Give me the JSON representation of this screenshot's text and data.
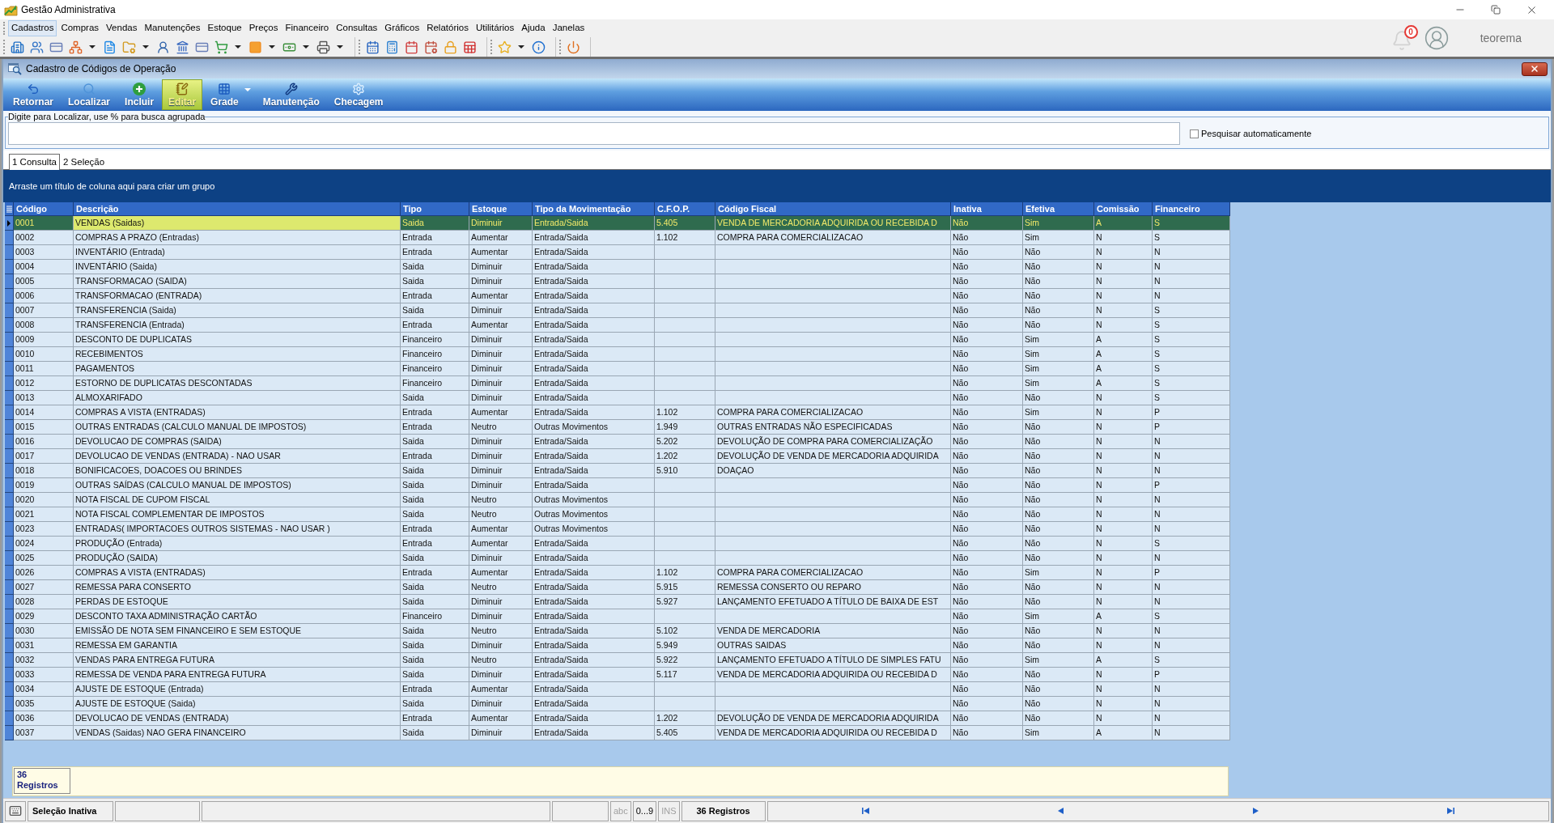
{
  "window": {
    "title": "Gestão Administrativa"
  },
  "menu": [
    {
      "label": "Cadastros",
      "selected": true
    },
    {
      "label": "Compras",
      "selected": false
    },
    {
      "label": "Vendas",
      "selected": false
    },
    {
      "label": "Manutenções",
      "selected": false
    },
    {
      "label": "Estoque",
      "selected": false
    },
    {
      "label": "Preços",
      "selected": false
    },
    {
      "label": "Financeiro",
      "selected": false
    },
    {
      "label": "Consultas",
      "selected": false
    },
    {
      "label": "Gráficos",
      "selected": false
    },
    {
      "label": "Relatórios",
      "selected": false
    },
    {
      "label": "Utilitários",
      "selected": false
    },
    {
      "label": "Ajuda",
      "selected": false
    },
    {
      "label": "Janelas",
      "selected": false
    }
  ],
  "toolbar": {
    "groups": [
      [
        {
          "dropdown": false
        },
        {
          "dropdown": false
        },
        {
          "dropdown": false
        },
        {
          "dropdown": true
        },
        {
          "dropdown": false
        },
        {
          "dropdown": true
        },
        {
          "dropdown": false
        },
        {
          "dropdown": false
        },
        {
          "dropdown": false
        },
        {
          "dropdown": true
        },
        {
          "dropdown": true
        },
        {
          "dropdown": true
        },
        {
          "dropdown": true
        }
      ],
      [
        {
          "dropdown": false
        },
        {
          "dropdown": false
        },
        {
          "dropdown": false
        },
        {
          "dropdown": false
        },
        {
          "dropdown": false
        },
        {
          "dropdown": false
        }
      ],
      [
        {
          "dropdown": true
        },
        {
          "dropdown": false
        }
      ],
      [
        {
          "dropdown": false
        }
      ]
    ]
  },
  "notifications": {
    "count": "0"
  },
  "user": {
    "name": "teorema"
  },
  "form": {
    "title": "Cadastro de Códigos de Operação",
    "buttons": [
      {
        "label": "Retornar",
        "selected": false,
        "dropdown": false
      },
      {
        "label": "Localizar",
        "selected": false,
        "dropdown": false
      },
      {
        "label": "Incluir",
        "selected": false,
        "dropdown": false
      },
      {
        "label": "Editar",
        "selected": true,
        "dropdown": false
      },
      {
        "label": "Grade",
        "selected": false,
        "dropdown": true
      },
      {
        "label": "Manutenção",
        "selected": false,
        "dropdown": false
      },
      {
        "label": "Checagem",
        "selected": false,
        "dropdown": false
      }
    ],
    "search": {
      "label": "Digite para Localizar, use % para busca agrupada",
      "auto_search": {
        "label": "Pesquisar automaticamente",
        "checked": false
      }
    },
    "tabs": [
      {
        "label": "1 Consulta",
        "selected": true
      },
      {
        "label": "2 Seleção",
        "selected": false
      }
    ],
    "group_panel": "Arraste um título de coluna aqui para criar um grupo",
    "table": {
      "columns": [
        {
          "label": "Código",
          "focused": false
        },
        {
          "label": "Descrição",
          "focused": true
        },
        {
          "label": "Tipo",
          "focused": false
        },
        {
          "label": "Estoque",
          "focused": false
        },
        {
          "label": "Tipo da Movimentação",
          "focused": false
        },
        {
          "label": "C.F.O.P.",
          "focused": false
        },
        {
          "label": "Código Fiscal",
          "focused": false
        },
        {
          "label": "Inativa",
          "focused": false
        },
        {
          "label": "Efetiva",
          "focused": false
        },
        {
          "label": "Comissão",
          "focused": false
        },
        {
          "label": "Financeiro",
          "focused": false
        }
      ],
      "rows": [
        {
          "selected": true,
          "codigo": "0001",
          "descricao": "VENDAS (Saidas)",
          "tipo": "Saida",
          "estoque": "Diminuir",
          "tipo_movimentacao": "Entrada/Saida",
          "cfop": "5.405",
          "codigo_fiscal": "VENDA DE MERCADORIA ADQUIRIDA OU RECEBIDA D",
          "inativa": "Não",
          "efetiva": "Sim",
          "comissao": "A",
          "financeiro": "S"
        },
        {
          "selected": false,
          "codigo": "0002",
          "descricao": "COMPRAS A PRAZO (Entradas)",
          "tipo": "Entrada",
          "estoque": "Aumentar",
          "tipo_movimentacao": "Entrada/Saida",
          "cfop": "1.102",
          "codigo_fiscal": "COMPRA PARA COMERCIALIZACAO",
          "inativa": "Não",
          "efetiva": "Sim",
          "comissao": "N",
          "financeiro": "S"
        },
        {
          "selected": false,
          "codigo": "0003",
          "descricao": "INVENTÁRIO (Entrada)",
          "tipo": "Entrada",
          "estoque": "Aumentar",
          "tipo_movimentacao": "Entrada/Saida",
          "inativa": "Não",
          "efetiva": "Não",
          "comissao": "N",
          "financeiro": "N"
        },
        {
          "selected": false,
          "codigo": "0004",
          "descricao": "INVENTÁRIO (Saida)",
          "tipo": "Saida",
          "estoque": "Diminuir",
          "tipo_movimentacao": "Entrada/Saida",
          "inativa": "Não",
          "efetiva": "Não",
          "comissao": "N",
          "financeiro": "N"
        },
        {
          "selected": false,
          "codigo": "0005",
          "descricao": "TRANSFORMACAO (SAIDA)",
          "tipo": "Saida",
          "estoque": "Diminuir",
          "tipo_movimentacao": "Entrada/Saida",
          "inativa": "Não",
          "efetiva": "Não",
          "comissao": "N",
          "financeiro": "N"
        },
        {
          "selected": false,
          "codigo": "0006",
          "descricao": "TRANSFORMACAO (ENTRADA)",
          "tipo": "Entrada",
          "estoque": "Aumentar",
          "tipo_movimentacao": "Entrada/Saida",
          "inativa": "Não",
          "efetiva": "Não",
          "comissao": "N",
          "financeiro": "N"
        },
        {
          "selected": false,
          "codigo": "0007",
          "descricao": "TRANSFERENCIA (Saida)",
          "tipo": "Saida",
          "estoque": "Diminuir",
          "tipo_movimentacao": "Entrada/Saida",
          "inativa": "Não",
          "efetiva": "Não",
          "comissao": "N",
          "financeiro": "S"
        },
        {
          "selected": false,
          "codigo": "0008",
          "descricao": "TRANSFERENCIA (Entrada)",
          "tipo": "Entrada",
          "estoque": "Aumentar",
          "tipo_movimentacao": "Entrada/Saida",
          "inativa": "Não",
          "efetiva": "Não",
          "comissao": "N",
          "financeiro": "S"
        },
        {
          "selected": false,
          "codigo": "0009",
          "descricao": "DESCONTO DE DUPLICATAS",
          "tipo": "Financeiro",
          "estoque": "Diminuir",
          "tipo_movimentacao": "Entrada/Saida",
          "inativa": "Não",
          "efetiva": "Sim",
          "comissao": "A",
          "financeiro": "S"
        },
        {
          "selected": false,
          "codigo": "0010",
          "descricao": "RECEBIMENTOS",
          "tipo": "Financeiro",
          "estoque": "Diminuir",
          "tipo_movimentacao": "Entrada/Saida",
          "inativa": "Não",
          "efetiva": "Sim",
          "comissao": "A",
          "financeiro": "S"
        },
        {
          "selected": false,
          "codigo": "0011",
          "descricao": "PAGAMENTOS",
          "tipo": "Financeiro",
          "estoque": "Diminuir",
          "tipo_movimentacao": "Entrada/Saida",
          "inativa": "Não",
          "efetiva": "Sim",
          "comissao": "A",
          "financeiro": "S"
        },
        {
          "selected": false,
          "codigo": "0012",
          "descricao": "ESTORNO DE DUPLICATAS DESCONTADAS",
          "tipo": "Financeiro",
          "estoque": "Diminuir",
          "tipo_movimentacao": "Entrada/Saida",
          "inativa": "Não",
          "efetiva": "Sim",
          "comissao": "A",
          "financeiro": "S"
        },
        {
          "selected": false,
          "codigo": "0013",
          "descricao": "ALMOXARIFADO",
          "tipo": "Saida",
          "estoque": "Diminuir",
          "tipo_movimentacao": "Entrada/Saida",
          "inativa": "Não",
          "efetiva": "Não",
          "comissao": "N",
          "financeiro": "S"
        },
        {
          "selected": false,
          "codigo": "0014",
          "descricao": "COMPRAS A VISTA (ENTRADAS)",
          "tipo": "Entrada",
          "estoque": "Aumentar",
          "tipo_movimentacao": "Entrada/Saida",
          "cfop": "1.102",
          "codigo_fiscal": "COMPRA PARA COMERCIALIZACAO",
          "inativa": "Não",
          "efetiva": "Sim",
          "comissao": "N",
          "financeiro": "P"
        },
        {
          "selected": false,
          "codigo": "0015",
          "descricao": "OUTRAS ENTRADAS (CALCULO MANUAL DE IMPOSTOS)",
          "tipo": "Entrada",
          "estoque": "Neutro",
          "tipo_movimentacao": "Outras Movimentos",
          "cfop": "1.949",
          "codigo_fiscal": "OUTRAS ENTRADAS NÃO ESPECIFICADAS",
          "inativa": "Não",
          "efetiva": "Não",
          "comissao": "N",
          "financeiro": "P"
        },
        {
          "selected": false,
          "codigo": "0016",
          "descricao": "DEVOLUCAO DE COMPRAS (SAIDA)",
          "tipo": "Saida",
          "estoque": "Diminuir",
          "tipo_movimentacao": "Entrada/Saida",
          "cfop": "5.202",
          "codigo_fiscal": "DEVOLUÇÃO DE COMPRA PARA COMERCIALIZAÇÃO",
          "inativa": "Não",
          "efetiva": "Não",
          "comissao": "N",
          "financeiro": "N"
        },
        {
          "selected": false,
          "codigo": "0017",
          "descricao": "DEVOLUCAO DE VENDAS (ENTRADA) - NAO USAR",
          "tipo": "Entrada",
          "estoque": "Diminuir",
          "tipo_movimentacao": "Entrada/Saida",
          "cfop": "1.202",
          "codigo_fiscal": "DEVOLUÇÃO DE VENDA DE MERCADORIA ADQUIRIDA",
          "inativa": "Não",
          "efetiva": "Não",
          "comissao": "N",
          "financeiro": "N"
        },
        {
          "selected": false,
          "codigo": "0018",
          "descricao": "BONIFICACOES, DOACOES OU BRINDES",
          "tipo": "Saida",
          "estoque": "Diminuir",
          "tipo_movimentacao": "Entrada/Saida",
          "cfop": "5.910",
          "codigo_fiscal": "DOAÇAO",
          "inativa": "Não",
          "efetiva": "Não",
          "comissao": "N",
          "financeiro": "N"
        },
        {
          "selected": false,
          "codigo": "0019",
          "descricao": "OUTRAS SAÍDAS (CALCULO MANUAL DE IMPOSTOS)",
          "tipo": "Saida",
          "estoque": "Diminuir",
          "tipo_movimentacao": "Entrada/Saida",
          "inativa": "Não",
          "efetiva": "Não",
          "comissao": "N",
          "financeiro": "P"
        },
        {
          "selected": false,
          "codigo": "0020",
          "descricao": "NOTA FISCAL DE CUPOM FISCAL",
          "tipo": "Saida",
          "estoque": "Neutro",
          "tipo_movimentacao": "Outras Movimentos",
          "inativa": "Não",
          "efetiva": "Não",
          "comissao": "N",
          "financeiro": "N"
        },
        {
          "selected": false,
          "codigo": "0021",
          "descricao": "NOTA FISCAL COMPLEMENTAR DE IMPOSTOS",
          "tipo": "Saida",
          "estoque": "Neutro",
          "tipo_movimentacao": "Outras Movimentos",
          "inativa": "Não",
          "efetiva": "Não",
          "comissao": "N",
          "financeiro": "N"
        },
        {
          "selected": false,
          "codigo": "0023",
          "descricao": "ENTRADAS( IMPORTACOES OUTROS SISTEMAS - NAO USAR )",
          "tipo": "Entrada",
          "estoque": "Aumentar",
          "tipo_movimentacao": "Outras Movimentos",
          "inativa": "Não",
          "efetiva": "Não",
          "comissao": "N",
          "financeiro": "N"
        },
        {
          "selected": false,
          "codigo": "0024",
          "descricao": "PRODUÇÃO (Entrada)",
          "tipo": "Entrada",
          "estoque": "Aumentar",
          "tipo_movimentacao": "Entrada/Saida",
          "inativa": "Não",
          "efetiva": "Não",
          "comissao": "N",
          "financeiro": "S"
        },
        {
          "selected": false,
          "codigo": "0025",
          "descricao": "PRODUÇÃO (SAIDA)",
          "tipo": "Saida",
          "estoque": "Diminuir",
          "tipo_movimentacao": "Entrada/Saida",
          "inativa": "Não",
          "efetiva": "Não",
          "comissao": "N",
          "financeiro": "N"
        },
        {
          "selected": false,
          "codigo": "0026",
          "descricao": "COMPRAS A VISTA (ENTRADAS)",
          "tipo": "Entrada",
          "estoque": "Aumentar",
          "tipo_movimentacao": "Entrada/Saida",
          "cfop": "1.102",
          "codigo_fiscal": "COMPRA PARA COMERCIALIZACAO",
          "inativa": "Não",
          "efetiva": "Sim",
          "comissao": "N",
          "financeiro": "P"
        },
        {
          "selected": false,
          "codigo": "0027",
          "descricao": "REMESSA PARA CONSERTO",
          "tipo": "Saida",
          "estoque": "Neutro",
          "tipo_movimentacao": "Entrada/Saida",
          "cfop": "5.915",
          "codigo_fiscal": "REMESSA CONSERTO OU REPARO",
          "inativa": "Não",
          "efetiva": "Não",
          "comissao": "N",
          "financeiro": "N"
        },
        {
          "selected": false,
          "codigo": "0028",
          "descricao": "PERDAS DE ESTOQUE",
          "tipo": "Saida",
          "estoque": "Diminuir",
          "tipo_movimentacao": "Entrada/Saida",
          "cfop": "5.927",
          "codigo_fiscal": "LANÇAMENTO EFETUADO A TÍTULO DE BAIXA DE EST",
          "inativa": "Não",
          "efetiva": "Não",
          "comissao": "N",
          "financeiro": "N"
        },
        {
          "selected": false,
          "codigo": "0029",
          "descricao": "DESCONTO TAXA ADMINISTRAÇÃO CARTÃO",
          "tipo": "Financeiro",
          "estoque": "Diminuir",
          "tipo_movimentacao": "Entrada/Saida",
          "inativa": "Não",
          "efetiva": "Sim",
          "comissao": "A",
          "financeiro": "S"
        },
        {
          "selected": false,
          "codigo": "0030",
          "descricao": "EMISSÃO DE NOTA SEM FINANCEIRO E SEM ESTOQUE",
          "tipo": "Saida",
          "estoque": "Neutro",
          "tipo_movimentacao": "Entrada/Saida",
          "cfop": "5.102",
          "codigo_fiscal": "VENDA DE MERCADORIA",
          "inativa": "Não",
          "efetiva": "Não",
          "comissao": "N",
          "financeiro": "N"
        },
        {
          "selected": false,
          "codigo": "0031",
          "descricao": "REMESSA EM GARANTIA",
          "tipo": "Saida",
          "estoque": "Diminuir",
          "tipo_movimentacao": "Entrada/Saida",
          "cfop": "5.949",
          "codigo_fiscal": "OUTRAS SAIDAS",
          "inativa": "Não",
          "efetiva": "Não",
          "comissao": "N",
          "financeiro": "N"
        },
        {
          "selected": false,
          "codigo": "0032",
          "descricao": "VENDAS PARA ENTREGA FUTURA",
          "tipo": "Saida",
          "estoque": "Neutro",
          "tipo_movimentacao": "Entrada/Saida",
          "cfop": "5.922",
          "codigo_fiscal": "LANÇAMENTO EFETUADO A TÍTULO DE SIMPLES FATU",
          "inativa": "Não",
          "efetiva": "Sim",
          "comissao": "A",
          "financeiro": "S"
        },
        {
          "selected": false,
          "codigo": "0033",
          "descricao": "REMESSA DE VENDA PARA ENTREGA FUTURA",
          "tipo": "Saida",
          "estoque": "Diminuir",
          "tipo_movimentacao": "Entrada/Saida",
          "cfop": "5.117",
          "codigo_fiscal": "VENDA DE MERCADORIA ADQUIRIDA OU RECEBIDA D",
          "inativa": "Não",
          "efetiva": "Não",
          "comissao": "N",
          "financeiro": "P"
        },
        {
          "selected": false,
          "codigo": "0034",
          "descricao": "AJUSTE DE ESTOQUE (Entrada)",
          "tipo": "Entrada",
          "estoque": "Aumentar",
          "tipo_movimentacao": "Entrada/Saida",
          "inativa": "Não",
          "efetiva": "Não",
          "comissao": "N",
          "financeiro": "N"
        },
        {
          "selected": false,
          "codigo": "0035",
          "descricao": "AJUSTE DE ESTOQUE (Saida)",
          "tipo": "Saida",
          "estoque": "Diminuir",
          "tipo_movimentacao": "Entrada/Saida",
          "inativa": "Não",
          "efetiva": "Não",
          "comissao": "N",
          "financeiro": "N"
        },
        {
          "selected": false,
          "codigo": "0036",
          "descricao": "DEVOLUCAO DE VENDAS (ENTRADA)",
          "tipo": "Entrada",
          "estoque": "Aumentar",
          "tipo_movimentacao": "Entrada/Saida",
          "cfop": "1.202",
          "codigo_fiscal": "DEVOLUÇÃO DE VENDA DE MERCADORIA ADQUIRIDA",
          "inativa": "Não",
          "efetiva": "Não",
          "comissao": "N",
          "financeiro": "N"
        },
        {
          "selected": false,
          "codigo": "0037",
          "descricao": "VENDAS (Saidas) NAO GERA FINANCEIRO",
          "tipo": "Saida",
          "estoque": "Diminuir",
          "tipo_movimentacao": "Entrada/Saida",
          "cfop": "5.405",
          "codigo_fiscal": "VENDA DE MERCADORIA ADQUIRIDA OU RECEBIDA D",
          "inativa": "Não",
          "efetiva": "Sim",
          "comissao": "A",
          "financeiro": "N"
        }
      ]
    },
    "footer_summary": "36 Registros"
  },
  "status_bar": {
    "selection": "Seleção Inativa",
    "indicators": [
      {
        "label": "abc",
        "active": false
      },
      {
        "label": "0...9",
        "active": true
      },
      {
        "label": "INS",
        "active": false
      }
    ],
    "records": "36 Registros"
  }
}
